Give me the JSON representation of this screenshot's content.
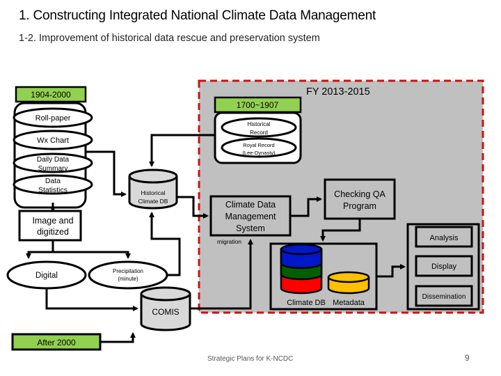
{
  "header": {
    "title": "1. Constructing Integrated National Climate Data Management",
    "subtitle": "1-2. Improvement of historical data rescue and preservation system"
  },
  "colors": {
    "green_label": "#92d050",
    "project_bg": "#c0c0c0",
    "project_border": "#cc1111",
    "db_fill": "#d9d9d9",
    "stack_blue": "#0018c8",
    "stack_green": "#006000",
    "stack_red": "#ff0000",
    "metadata_yellow": "#ffc000"
  },
  "left_group": {
    "label": "1904-2000",
    "items": [
      "Roll-paper",
      "Wx Chart",
      "Daily Data Summary",
      "Data Statistics"
    ]
  },
  "image_box": "Image and digitized",
  "digital": "Digital",
  "precipitation": [
    "Precipitation",
    "(minute)"
  ],
  "historical_db": [
    "Historical",
    "Climate DB"
  ],
  "comis": "COMIS",
  "after_2000": "After 2000",
  "project": {
    "label": "FY 2013-2015",
    "old_group": {
      "label": "1700~1907",
      "items": [
        [
          "Historical",
          "Record"
        ],
        [
          "Royal Record",
          "(Lee-Dynasty)"
        ]
      ]
    },
    "cdms": [
      "Climate Data",
      "Management",
      "System"
    ],
    "qa": [
      "Checking QA",
      "Program"
    ],
    "migration": "migration",
    "climate_db": "Climate DB",
    "metadata": "Metadata",
    "outputs": [
      "Analysis",
      "Display",
      "Dissemination"
    ]
  },
  "footer": {
    "text": "Strategic Plans for K-NCDC",
    "page": "9"
  }
}
